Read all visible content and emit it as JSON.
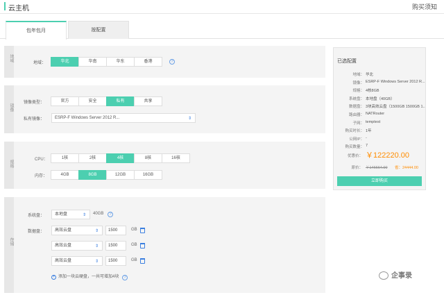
{
  "header": {
    "title": "云主机",
    "notice": "购买须知"
  },
  "tabs": [
    {
      "label": "包年包月"
    },
    {
      "label": "按配置"
    }
  ],
  "region": {
    "side": "地域",
    "label": "地域：",
    "options": [
      "华北",
      "华南",
      "华东",
      "香港"
    ],
    "help": "?"
  },
  "image": {
    "side": "镜像",
    "type_label": "镜像类型：",
    "type_options": [
      "官方",
      "安全",
      "私有",
      "共享"
    ],
    "private_label": "私有镜像：",
    "private_value": "ESRP-F Windows Server 2012 R..."
  },
  "spec": {
    "side": "规格",
    "cpu_label": "CPU：",
    "cpu_options": [
      "1核",
      "2核",
      "4核",
      "8核",
      "16核"
    ],
    "mem_label": "内存：",
    "mem_options": [
      "4GB",
      "8GB",
      "12GB",
      "16GB"
    ]
  },
  "storage": {
    "side": "存储",
    "sys_label": "系统盘：",
    "sys_type": "本地盘",
    "sys_size": "40GB",
    "data_label": "数据盘：",
    "disks": [
      {
        "type": "高效云盘",
        "size": "1500",
        "unit": "GB"
      },
      {
        "type": "高效云盘",
        "size": "1500",
        "unit": "GB"
      },
      {
        "type": "高效云盘",
        "size": "1500",
        "unit": "GB"
      }
    ],
    "add_text": "添加一块云硬盘，一共可增加4块"
  },
  "summary": {
    "title": "已选配置",
    "rows": [
      {
        "k": "地域：",
        "v": "华北"
      },
      {
        "k": "镜像：",
        "v": "ESRP-F Windows Server 2012 R..."
      },
      {
        "k": "规格：",
        "v": "4核8GB"
      },
      {
        "k": "系统盘：",
        "v": "本地盘（40GB）"
      },
      {
        "k": "数据盘：",
        "v": "3块高效云盘（1500GB 1500GB 1..."
      },
      {
        "k": "路由器：",
        "v": "NATRouter"
      },
      {
        "k": "子网：",
        "v": "temptest"
      },
      {
        "k": "购买时长：",
        "v": "1年"
      },
      {
        "k": "公网IP：",
        "v": "-"
      },
      {
        "k": "购买数量：",
        "v": "7"
      }
    ],
    "price_label": "优惠价：",
    "price": "￥122220.00",
    "orig_label": "原价：",
    "orig": "￥146664.00",
    "save": "省：24444.00",
    "buy": "立即购买"
  },
  "watermark": "企事录",
  "colors": {
    "accent": "#4ccfb0",
    "price": "#ff8c00",
    "link": "#3b7fe0"
  }
}
